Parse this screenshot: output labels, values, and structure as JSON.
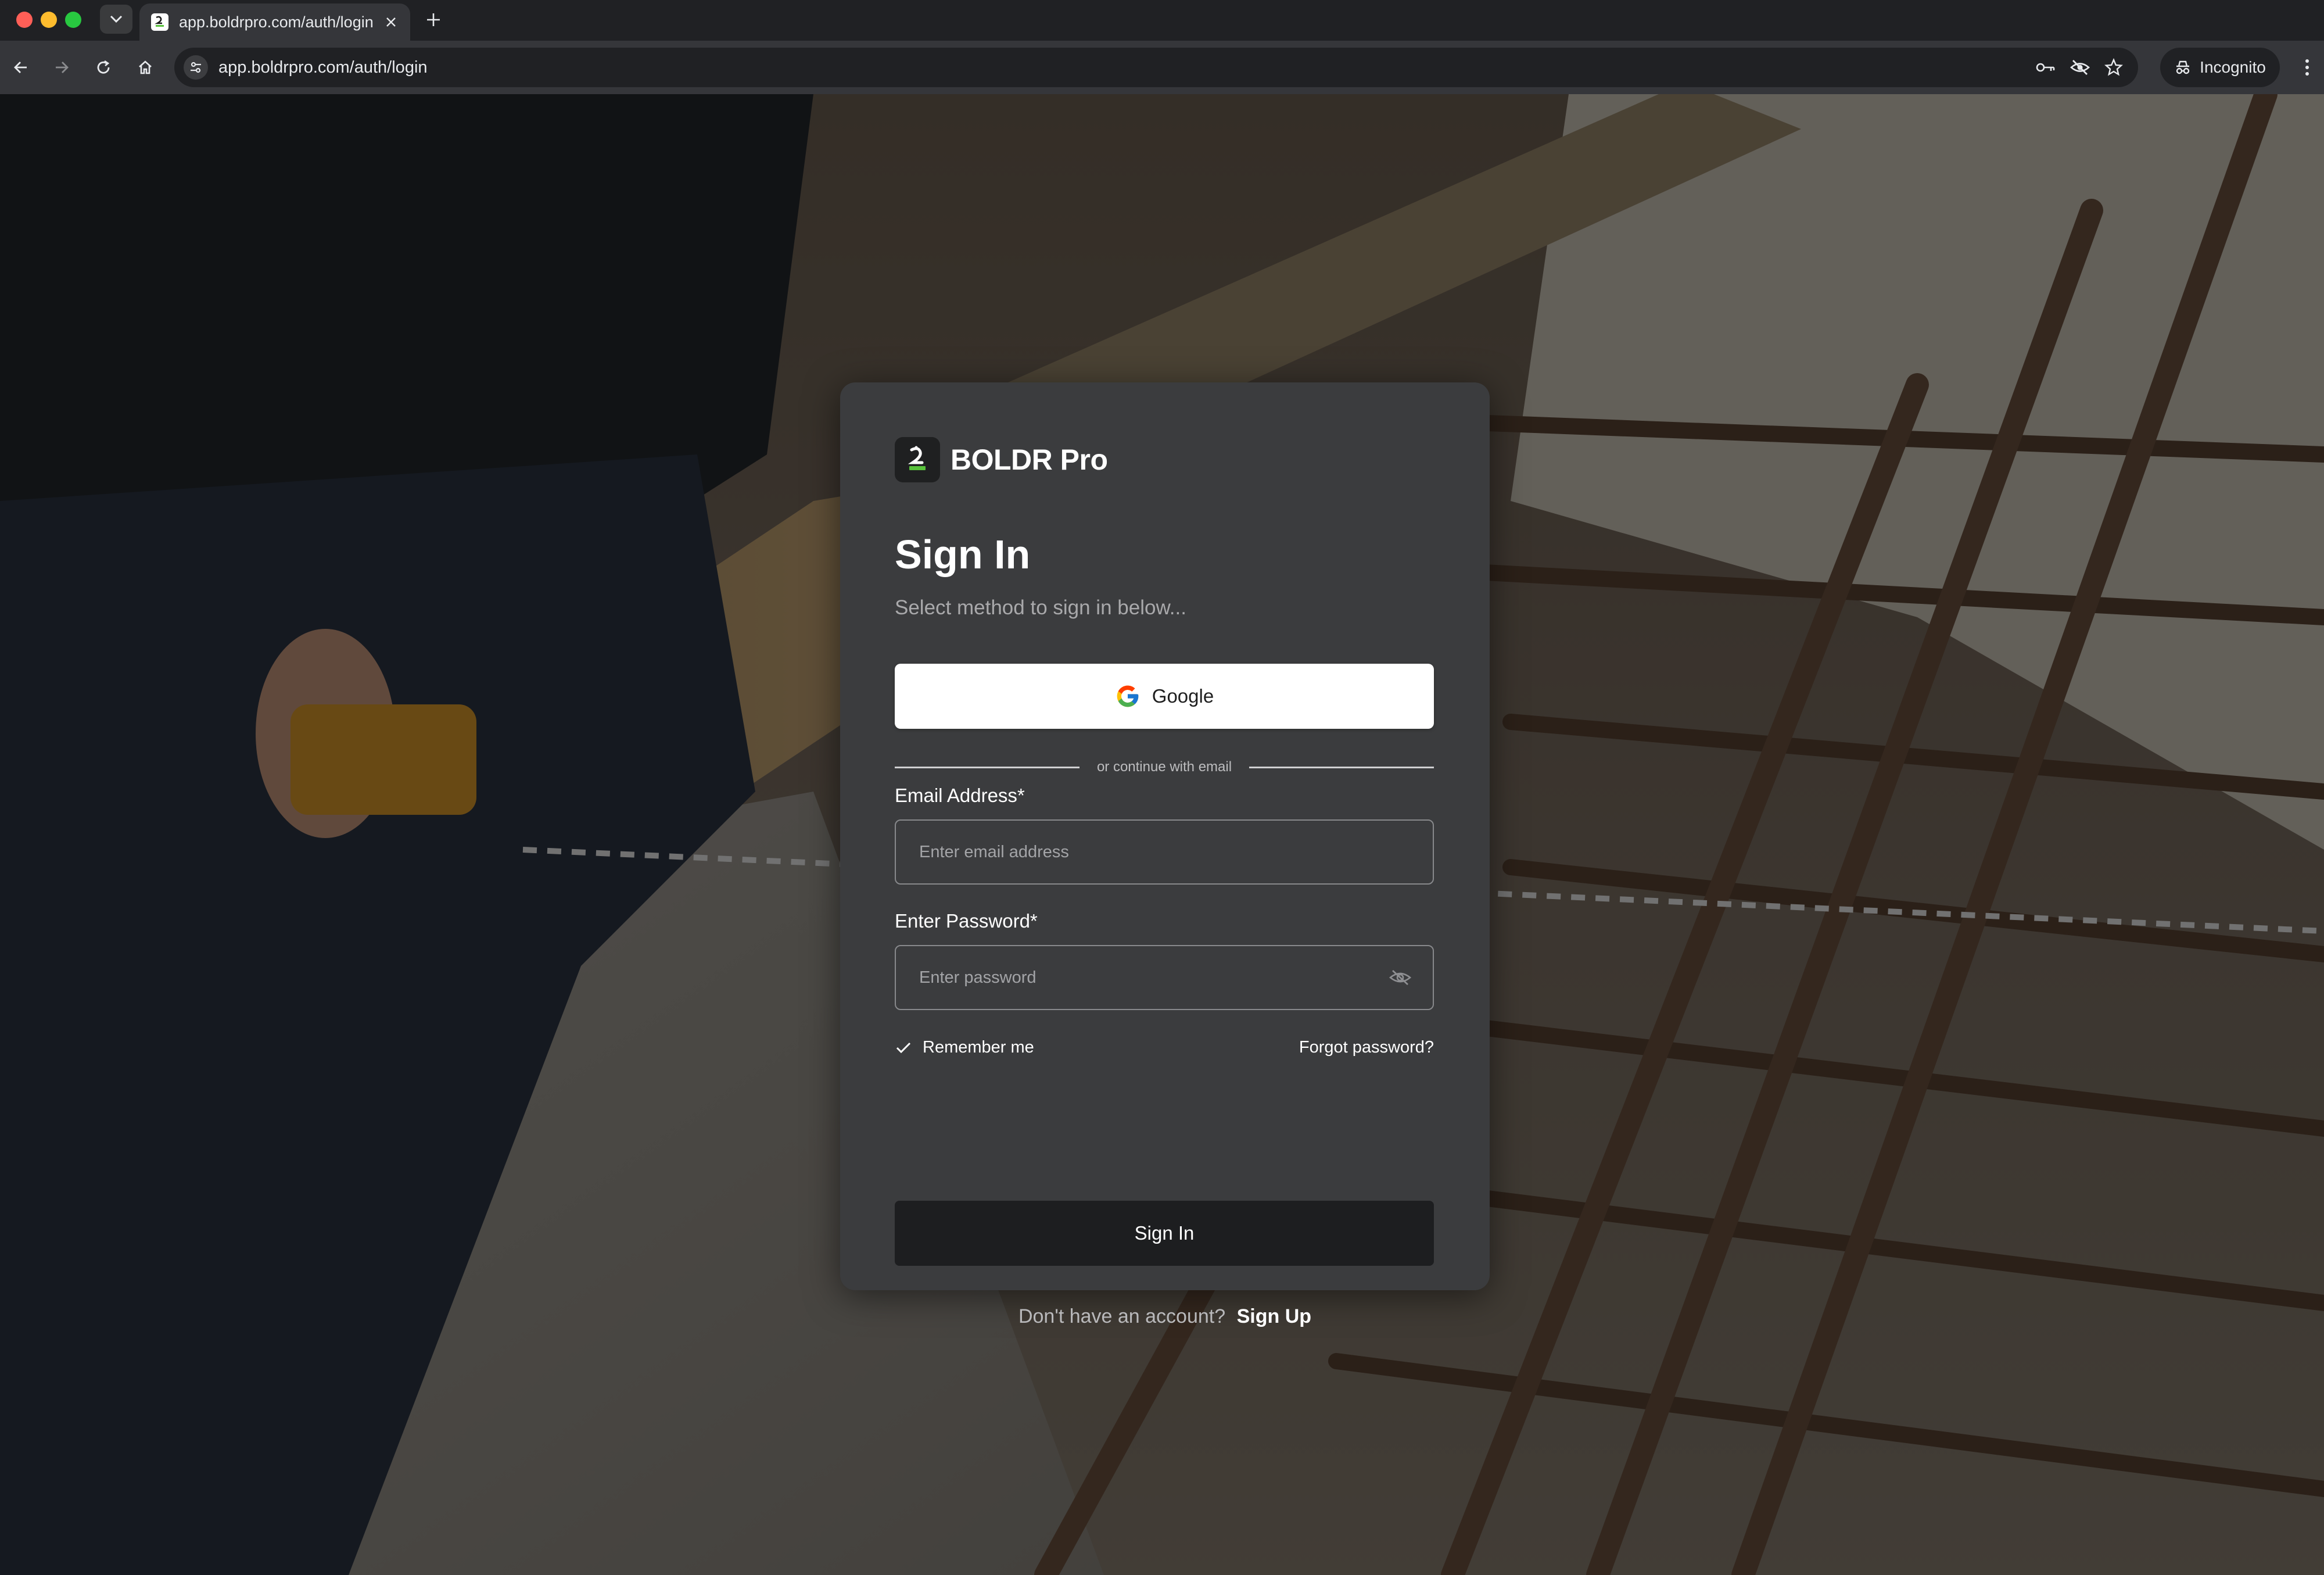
{
  "browser": {
    "tab_title": "app.boldrpro.com/auth/login",
    "url": "app.boldrpro.com/auth/login",
    "incognito_label": "Incognito",
    "icons": [
      "tab-list-icon",
      "close-icon",
      "plus-icon",
      "back-icon",
      "forward-icon",
      "reload-icon",
      "home-icon",
      "site-settings-icon",
      "key-icon",
      "eye-off-icon",
      "star-icon",
      "incognito-icon",
      "more-vert-icon"
    ]
  },
  "login": {
    "brand_name": "BOLDR Pro",
    "title": "Sign In",
    "subtitle": "Select method to sign in below...",
    "google_label": "Google",
    "divider_text": "or continue with email",
    "email_label": "Email Address*",
    "email_placeholder": "Enter email address",
    "email_value": "",
    "password_label": "Enter Password*",
    "password_placeholder": "Enter password",
    "password_value": "",
    "remember_label": "Remember me",
    "remember_checked": true,
    "forgot_label": "Forgot password?",
    "submit_label": "Sign In",
    "signup_prompt": "Don't have an account?",
    "signup_link": "Sign Up"
  },
  "colors": {
    "card_bg": "#3b3c3e",
    "button_dark": "#1d1e20",
    "brand_accent": "#58c23b"
  }
}
